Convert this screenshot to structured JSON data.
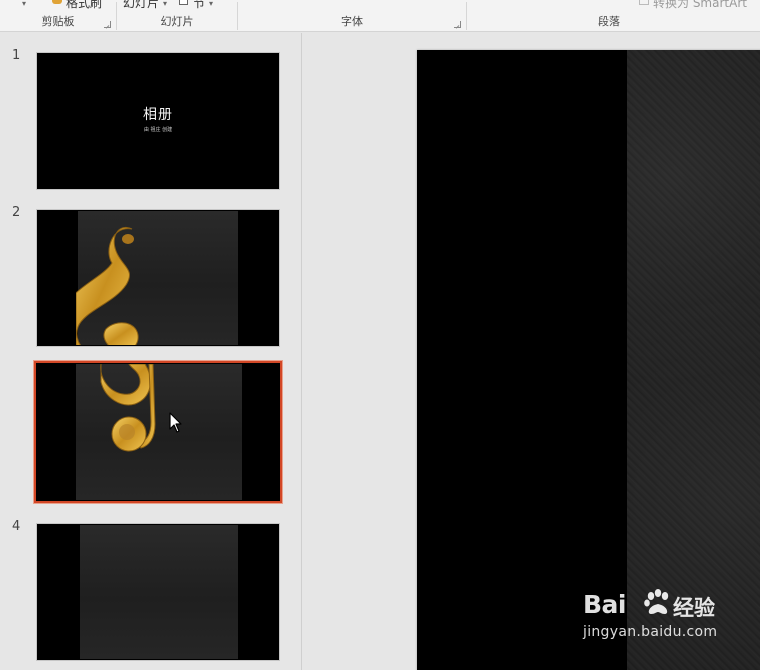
{
  "ribbon": {
    "clipboard": {
      "label": "剪贴板",
      "format_painter_partial": "格式刷"
    },
    "slides": {
      "label": "幻灯片",
      "new_slide_partial": "幻灯片",
      "section_partial": "节"
    },
    "font": {
      "label": "字体"
    },
    "paragraph": {
      "label": "段落",
      "smartart_partial": "转换为 SmartArt"
    }
  },
  "slides": [
    {
      "number": "1",
      "title": "相册",
      "subtitle": "由 祖庄 创建"
    },
    {
      "number": "2"
    },
    {
      "number": ""
    },
    {
      "number": "4"
    }
  ],
  "selected_slide_index": 3,
  "colors": {
    "selection": "#d24726",
    "gold": "#d4a33a"
  },
  "watermark": {
    "brand": "Bai",
    "brand2": "经验",
    "url": "jingyan.baidu.com"
  }
}
